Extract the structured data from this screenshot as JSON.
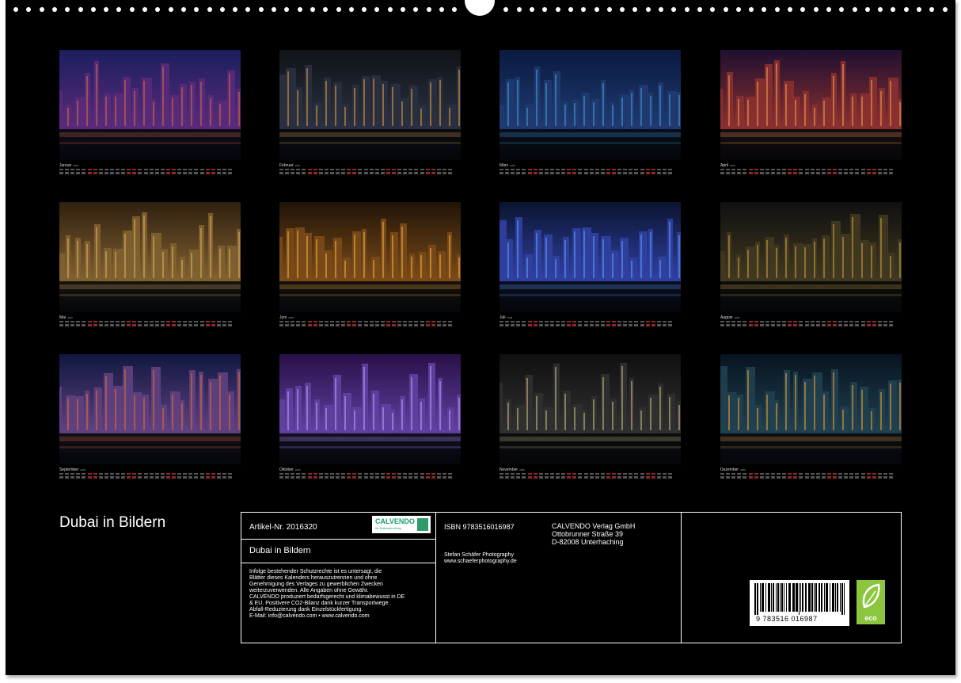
{
  "calendar": {
    "months": [
      {
        "name": "Januar",
        "year": "2026"
      },
      {
        "name": "Februar",
        "year": "2026"
      },
      {
        "name": "März",
        "year": "2026"
      },
      {
        "name": "April",
        "year": "2026"
      },
      {
        "name": "Mai",
        "year": "2026"
      },
      {
        "name": "Juni",
        "year": "2026"
      },
      {
        "name": "Juli",
        "year": "2026"
      },
      {
        "name": "August",
        "year": "2026"
      },
      {
        "name": "September",
        "year": "2026"
      },
      {
        "name": "Oktober",
        "year": "2026"
      },
      {
        "name": "November",
        "year": "2026"
      },
      {
        "name": "Dezember",
        "year": "2026"
      }
    ]
  },
  "title": "Dubai in Bildern",
  "info": {
    "artikel": "Artikel-Nr. 2016320",
    "logo_text": "CALVENDO",
    "logo_sub": "Ihr Kalenderverlag",
    "box_title": "Dubai in Bildern",
    "legal_lines": [
      "Infolge bestehender Schutzrechte ist es untersagt, die",
      "Blätter dieses Kalenders herauszutrennen und ohne",
      "Genehmigung des Verlages zu gewerblichen Zwecken",
      "weiterzuverwenden. Alle Angaben ohne Gewähr.",
      "CALVENDO produziert bedarfsgerecht und klimabewusst in DE",
      "& EU. Positivere CO2-Bilanz dank kurzer Transportwege.",
      "Abfall-Reduzierung dank Einzelstückfertigung.",
      "E-Mail: info@calvendo.com • www.calvendo.com"
    ],
    "isbn": "ISBN 9783516016987",
    "photographer": "Stefan Schäfer Photography",
    "website": "www.schaeferphotography.de",
    "publisher_name": "CALVENDO Verlag GmbH",
    "publisher_street": "Ottobrunner Straße 39",
    "publisher_city": "D-82008 Unterhaching",
    "barcode_number": "9 783516 016987",
    "eco_label": "eco"
  },
  "colors": {
    "accent": "#1a9c74",
    "eco": "#8cc63f"
  }
}
